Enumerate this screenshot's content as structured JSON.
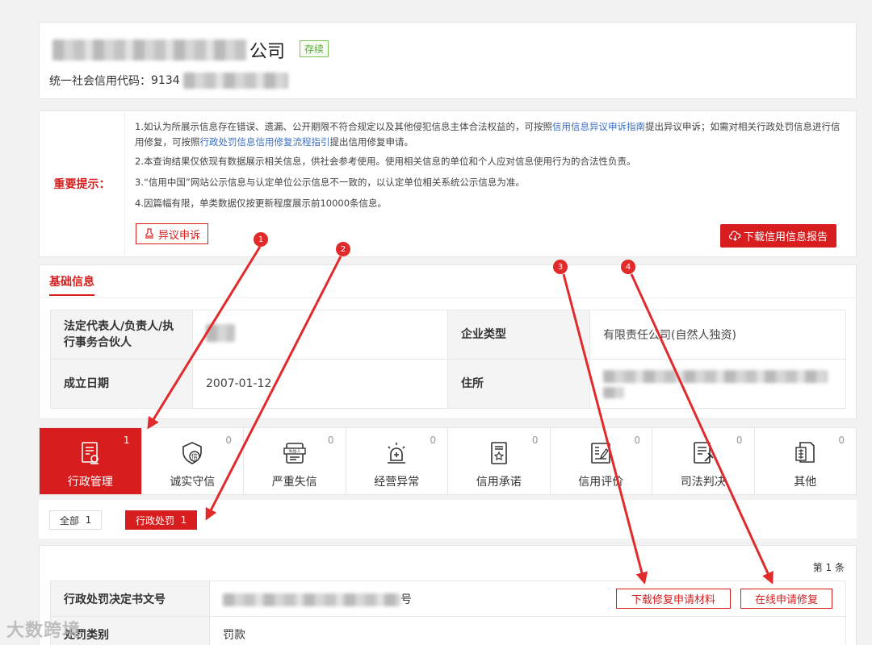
{
  "header": {
    "company_suffix": "公司",
    "status": "存续",
    "credit_code_label": "统一社会信用代码：",
    "credit_code_prefix": "9134"
  },
  "notice": {
    "label": "重要提示：",
    "line1_a": "1.如认为所展示信息存在错误、遗漏、公开期限不符合规定以及其他侵犯信息主体合法权益的，可按照",
    "line1_link1": "信用信息异议申诉指南",
    "line1_b": "提出异议申诉；如需对相关行政处罚信息进行信用修复，可按照",
    "line1_link2": "行政处罚信息信用修复流程指引",
    "line1_c": "提出信用修复申请。",
    "line2": "2.本查询结果仅依现有数据展示相关信息，供社会参考使用。使用相关信息的单位和个人应对信息使用行为的合法性负责。",
    "line3": "3.“信用中国”网站公示信息与认定单位公示信息不一致的，以认定单位相关系统公示信息为准。",
    "line4": "4.因篇幅有限，单类数据仅按更新程度展示前10000条信息。",
    "objection_button": "异议申诉",
    "download_button": "下载信用信息报告"
  },
  "basic_info": {
    "title": "基础信息",
    "legal_rep_label": "法定代表人/负责人/执行事务合伙人",
    "enterprise_type_label": "企业类型",
    "enterprise_type_value": "有限责任公司(自然人独资)",
    "founded_label": "成立日期",
    "founded_value": "2007-01-12",
    "address_label": "住所"
  },
  "tabs": [
    {
      "label": "行政管理",
      "count": "1",
      "icon": "admin-management-icon"
    },
    {
      "label": "诚实守信",
      "count": "0",
      "icon": "honesty-shield-icon"
    },
    {
      "label": "严重失信",
      "count": "0",
      "icon": "serious-dishonesty-icon"
    },
    {
      "label": "经营异常",
      "count": "0",
      "icon": "alarm-icon"
    },
    {
      "label": "信用承诺",
      "count": "0",
      "icon": "commitment-doc-icon"
    },
    {
      "label": "信用评价",
      "count": "0",
      "icon": "evaluation-icon"
    },
    {
      "label": "司法判决",
      "count": "0",
      "icon": "judgment-icon"
    },
    {
      "label": "其他",
      "count": "0",
      "icon": "other-docs-icon"
    }
  ],
  "filters": {
    "all_label": "全部",
    "all_count": "1",
    "penalty_label": "行政处罚",
    "penalty_count": "1"
  },
  "records": {
    "count_text": "第 1 条",
    "decision_no_label": "行政处罚决定书文号",
    "decision_no_suffix": "号",
    "category_label": "处罚类别",
    "category_value": "罚款",
    "repair_material_button": "下载修复申请材料",
    "online_repair_button": "在线申请修复"
  },
  "annotations": [
    "1",
    "2",
    "3",
    "4"
  ],
  "watermark": "大数跨境",
  "colors": {
    "accent": "#d71d1d",
    "link": "#3b6fc2",
    "status_green": "#5aa63a"
  }
}
